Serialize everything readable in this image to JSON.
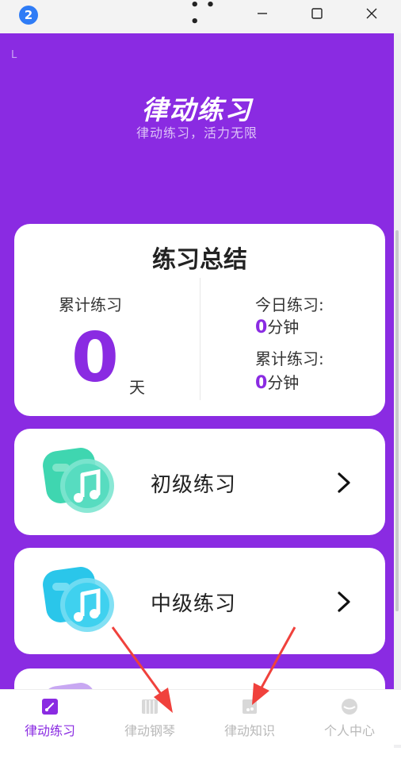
{
  "window": {
    "badge": "2",
    "controls": [
      "more",
      "minimize",
      "maximize",
      "close"
    ]
  },
  "app": {
    "corner_mark": "L",
    "title": "律动练习",
    "subtitle": "律动练习，活力无限",
    "accent_color": "#8a2be2"
  },
  "summary": {
    "title": "练习总结",
    "total_label": "累计练习",
    "total_days": "0",
    "days_unit": "天",
    "today_label": "今日练习:",
    "today_value": "0",
    "today_unit": "分钟",
    "cumulative_label": "累计练习:",
    "cumulative_value": "0",
    "cumulative_unit": "分钟"
  },
  "levels": [
    {
      "label": "初级练习",
      "icon": "music-note-icon",
      "color": "#3fd6b0"
    },
    {
      "label": "中级练习",
      "icon": "music-note-icon",
      "color": "#2ac6ea"
    },
    {
      "label": "",
      "icon": "music-note-icon",
      "color": "#c8a8f2"
    }
  ],
  "tabs": [
    {
      "label": "律动练习",
      "icon": "rhythm-icon",
      "active": true
    },
    {
      "label": "律动钢琴",
      "icon": "piano-icon",
      "active": false
    },
    {
      "label": "律动知识",
      "icon": "book-icon",
      "active": false
    },
    {
      "label": "个人中心",
      "icon": "profile-icon",
      "active": false
    }
  ]
}
